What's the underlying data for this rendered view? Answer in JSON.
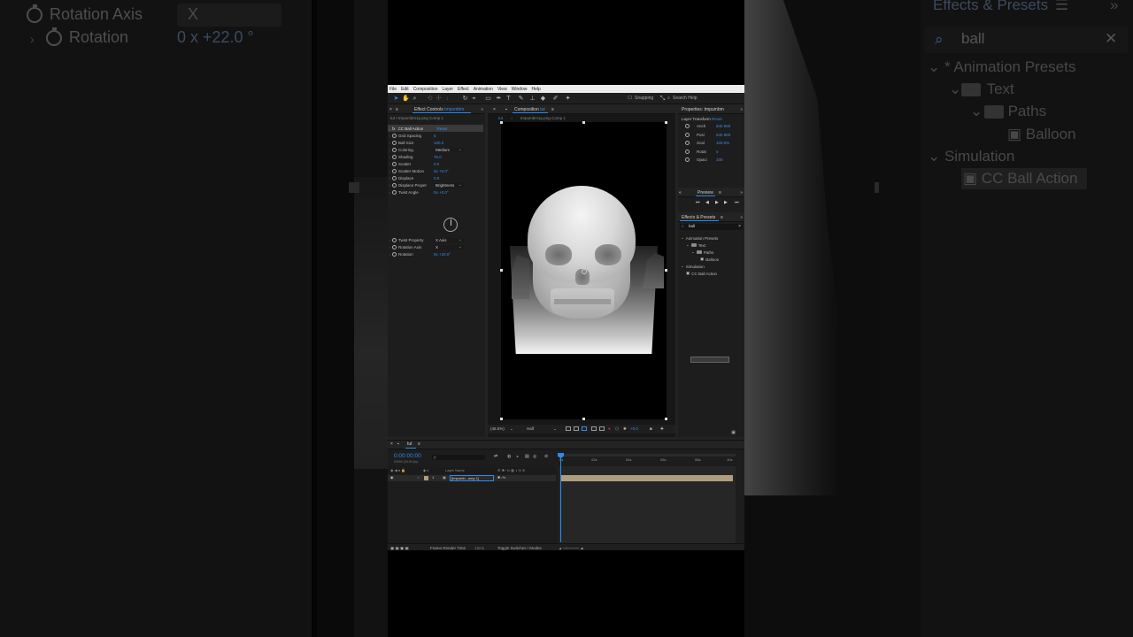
{
  "background": {
    "left_rows": [
      {
        "label": "Rotation Axis",
        "value": "X"
      },
      {
        "label": "Rotation",
        "value": "0 x +22.0 °"
      }
    ],
    "right_panel": {
      "title": "Effects & Presets",
      "search": "ball",
      "tree": [
        "Animation Presets",
        "Text",
        "Paths",
        "Balloon",
        "Simulation",
        "CC Ball Action"
      ]
    }
  },
  "menubar": [
    "File",
    "Edit",
    "Composition",
    "Layer",
    "Effect",
    "Animation",
    "View",
    "Window",
    "Help"
  ],
  "toolbar": {
    "snapping": "Snapping",
    "search_help": "Search Help"
  },
  "effect_controls": {
    "tab_title": "Effect Controls",
    "tab_sub": "tmpumbm",
    "subtitle": "tut • tmpumbm1p.png Comp 1",
    "effect_name": "CC Ball Action",
    "reset": "Reset",
    "properties": [
      {
        "name": "Grid Spacing",
        "value": "5",
        "kind": "value"
      },
      {
        "name": "Ball Size",
        "value": "100.0",
        "kind": "value"
      },
      {
        "name": "Coloring",
        "value": "Medium",
        "kind": "dropdown"
      },
      {
        "name": "Shading",
        "value": "75.0",
        "kind": "value"
      },
      {
        "name": "Scatter",
        "value": "0.0",
        "kind": "value"
      },
      {
        "name": "Scatter Motion",
        "value": "0x +0.0°",
        "kind": "value"
      },
      {
        "name": "Displace",
        "value": "0.0",
        "kind": "value"
      },
      {
        "name": "Displace Proper",
        "value": "Brightness",
        "kind": "dropdown"
      },
      {
        "name": "Twist Angle",
        "value": "0x +0.0°",
        "kind": "value"
      }
    ],
    "properties_lower": [
      {
        "name": "Twist Property",
        "value": "X Axis",
        "kind": "dropdown"
      },
      {
        "name": "Rotation Axis",
        "value": "X",
        "kind": "dropdown"
      },
      {
        "name": "Rotation",
        "value": "0x +22.0°",
        "kind": "value"
      }
    ]
  },
  "composition": {
    "tab_title": "Composition",
    "tab_sub": "tut",
    "crumb_1": "tut",
    "crumb_2": "tmpumbm1p.png Comp 1",
    "zoom": "(46.5%)",
    "resolution": "Half",
    "exposure": "+0.0"
  },
  "properties_panel": {
    "title": "Properties: tmpumbm",
    "section": "Layer Transform",
    "reset": "Reset",
    "rows": [
      {
        "name": "Anch",
        "value": "540 960"
      },
      {
        "name": "Posi",
        "value": "540 960"
      },
      {
        "name": "Scal",
        "value": "100.0%"
      },
      {
        "name": "Rotat",
        "value": "0"
      },
      {
        "name": "Opaci",
        "value": "100"
      }
    ]
  },
  "preview_panel": {
    "title": "Preview"
  },
  "effects_presets": {
    "title": "Effects & Presets",
    "search": "ball",
    "tree": [
      {
        "label": "Animation Presets",
        "level": 0,
        "type": "root"
      },
      {
        "label": "Text",
        "level": 1,
        "type": "folder"
      },
      {
        "label": "Paths",
        "level": 2,
        "type": "folder"
      },
      {
        "label": "Balloon",
        "level": 3,
        "type": "preset"
      },
      {
        "label": "Simulation",
        "level": 0,
        "type": "root"
      },
      {
        "label": "CC Ball Action",
        "level": 1,
        "type": "effect"
      }
    ]
  },
  "timeline": {
    "tab": "tut",
    "timecode": "0:00:00:00",
    "fps": "00000 (30.00 fps)",
    "search_placeholder": "ρ",
    "col_layer_name": "Layer Name",
    "layer_index": "1",
    "layer_name": "[tmpumb...omp 1]",
    "ruler": [
      "0s",
      "02s",
      "04s",
      "06s",
      "08s",
      "10s"
    ],
    "footer_render": "Frame Render Time",
    "footer_render_val": "16ms",
    "footer_toggle": "Toggle Switches / Modes"
  }
}
